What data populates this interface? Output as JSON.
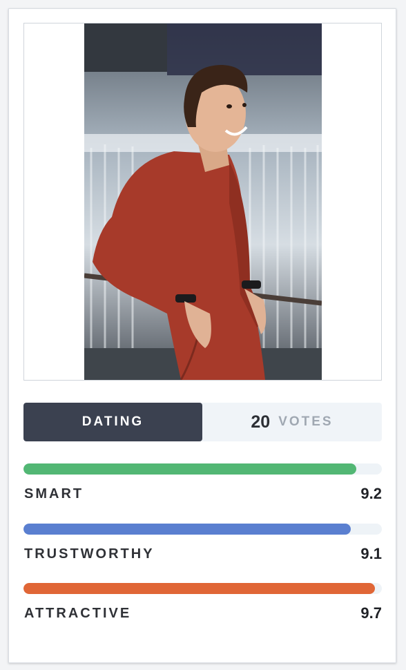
{
  "card": {
    "photo_alt": "Smiling man in red button-up shirt leaning on a railing"
  },
  "tabs": {
    "active_label": "DATING"
  },
  "votes": {
    "count": "20",
    "label": "VOTES"
  },
  "metrics": [
    {
      "name": "SMART",
      "score": "9.2",
      "fraction": 0.928,
      "color": "#52b774"
    },
    {
      "name": "TRUSTWORTHY",
      "score": "9.1",
      "fraction": 0.914,
      "color": "#5a7fd0"
    },
    {
      "name": "ATTRACTIVE",
      "score": "9.7",
      "fraction": 0.981,
      "color": "#e06636"
    }
  ]
}
